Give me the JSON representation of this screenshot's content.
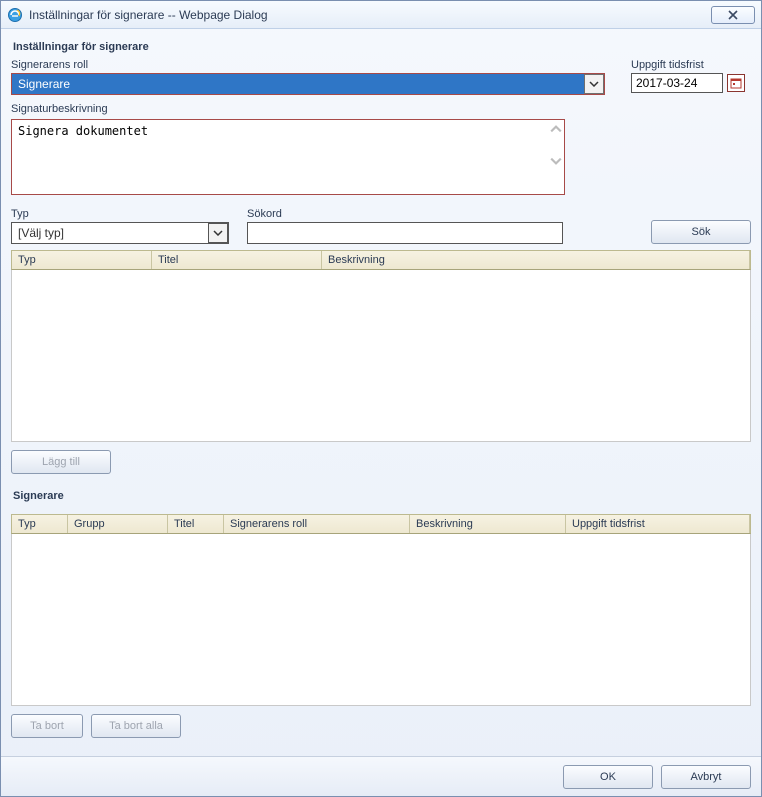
{
  "window": {
    "title": "Inställningar för signerare -- Webpage Dialog"
  },
  "section1": {
    "heading": "Inställningar för signerare",
    "roleLabel": "Signerarens roll",
    "roleValue": "Signerare",
    "deadlineLabel": "Uppgift tidsfrist",
    "deadlineValue": "2017-03-24",
    "descLabel": "Signaturbeskrivning",
    "descValue": "Signera dokumentet",
    "typLabel": "Typ",
    "typValue": "[Välj typ]",
    "sokLabel": "Sökord",
    "sokValue": "",
    "sokButton": "Sök",
    "table1": {
      "colTyp": "Typ",
      "colTitel": "Titel",
      "colBeskr": "Beskrivning"
    },
    "addButton": "Lägg till"
  },
  "section2": {
    "heading": "Signerare",
    "table2": {
      "colTyp": "Typ",
      "colGrupp": "Grupp",
      "colTitel": "Titel",
      "colRoll": "Signerarens roll",
      "colBeskr": "Beskrivning",
      "colTid": "Uppgift tidsfrist"
    },
    "removeButton": "Ta bort",
    "removeAllButton": "Ta bort alla"
  },
  "footer": {
    "ok": "OK",
    "cancel": "Avbryt"
  }
}
